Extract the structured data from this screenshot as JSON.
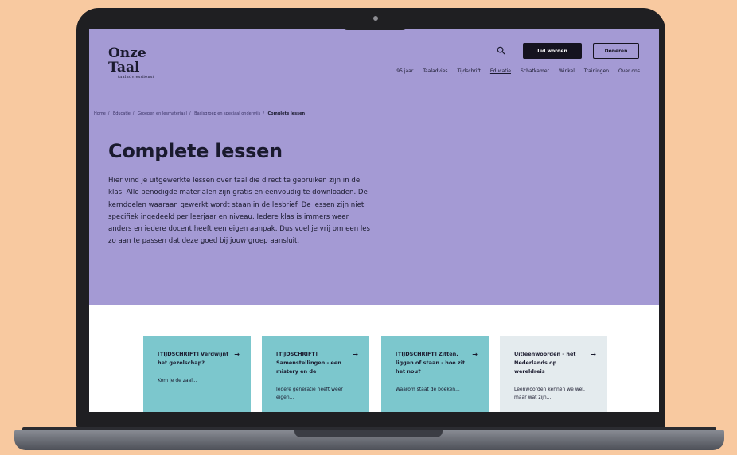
{
  "site": {
    "logo_line1": "Onze",
    "logo_line2": "Taal",
    "logo_tagline": "taaladviesdienst"
  },
  "header": {
    "member_button": "Lid worden",
    "donate_button": "Doneren",
    "nav": [
      "95 jaar",
      "Taaladvies",
      "Tijdschrift",
      "Educatie",
      "Schatkamer",
      "Winkel",
      "Trainingen",
      "Over ons"
    ],
    "active_nav": "Educatie"
  },
  "breadcrumb": {
    "items": [
      "Home",
      "Educatie",
      "Groepen en lesmateriaal",
      "Basisgroep en speciaal onderwijs",
      "Complete lessen"
    ],
    "current": "Complete lessen"
  },
  "main": {
    "title": "Complete lessen",
    "intro": "Hier vind je uitgewerkte lessen over taal die direct te gebruiken zijn in de klas. Alle benodigde materialen zijn gratis en eenvoudig te downloaden. De kerndoelen waaraan gewerkt wordt staan in de lesbrief. De lessen zijn niet specifiek ingedeeld per leerjaar en niveau. Iedere klas is immers weer anders en iedere docent heeft een eigen aanpak. Dus voel je vrij om een les zo aan te passen dat deze goed bij jouw groep aansluit."
  },
  "cards": [
    {
      "title": "[TIJDSCHRIFT] Verdwijnt het gezelschap?",
      "desc": "Kom je de zaal...",
      "arrow": "→"
    },
    {
      "title": "[TIJDSCHRIFT] Samenstellingen - een mistery en de",
      "desc": "Iedere generatie heeft weer eigen...",
      "arrow": "→"
    },
    {
      "title": "[TIJDSCHRIFT] Zitten, liggen of staan - hoe zit het nou?",
      "desc": "Waarom staat de boeken...",
      "arrow": "→"
    },
    {
      "title": "Uitleenwoorden - het Nederlands op wereldreis",
      "desc": "Leenwoorden kennen we wel, maar wat zijn...",
      "arrow": "→"
    }
  ],
  "icons": {
    "search": "search-icon"
  },
  "colors": {
    "hero_bg": "#a49ad4",
    "card_bg": "#7cc7cd",
    "card_alt_bg": "#e4ebee",
    "page_bg": "#f8c9a0"
  }
}
